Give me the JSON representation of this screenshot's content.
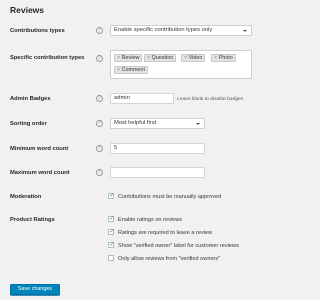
{
  "section": {
    "title": "Reviews"
  },
  "rows": {
    "contribution_types": {
      "label": "Contributions types",
      "help_icon": "?",
      "selected_value": "Enable specific contribution types only"
    },
    "specific_contribution_types": {
      "label": "Specific contribution types",
      "help_icon": "?",
      "chip_remove_symbol": "×",
      "chips": [
        "Review",
        "Question",
        "Video",
        "Photo",
        "Comment"
      ]
    },
    "admin_badges": {
      "label": "Admin Badges",
      "help_icon": "?",
      "value": "admin",
      "description": "Leave blank to disable badges."
    },
    "sorting_order": {
      "label": "Sorting order",
      "help_icon": "?",
      "selected_value": "Most helpful first"
    },
    "minimum_word_count": {
      "label": "Minimum word count",
      "help_icon": "?",
      "value": "5"
    },
    "maximum_word_count": {
      "label": "Maximum word count",
      "help_icon": "?",
      "value": ""
    },
    "moderation": {
      "label": "Moderation",
      "checkbox_label": "Contributions must be manually approved",
      "checked": true
    },
    "product_ratings": {
      "label": "Product Ratings",
      "options": [
        {
          "label": "Enable ratings on reviews",
          "checked": true
        },
        {
          "label": "Ratings are required to leave a review",
          "checked": true
        },
        {
          "label": "Show \"verified owner\" label for customer reviews",
          "checked": true
        },
        {
          "label": "Only allow reviews from \"verified owners\"",
          "checked": false
        }
      ]
    }
  },
  "check_symbol": "✓",
  "save_button": {
    "label": "Save changes"
  },
  "colors": {
    "primary": "#0085ba",
    "checkmark": "#1e8cbe",
    "background": "#f1f1f1"
  }
}
